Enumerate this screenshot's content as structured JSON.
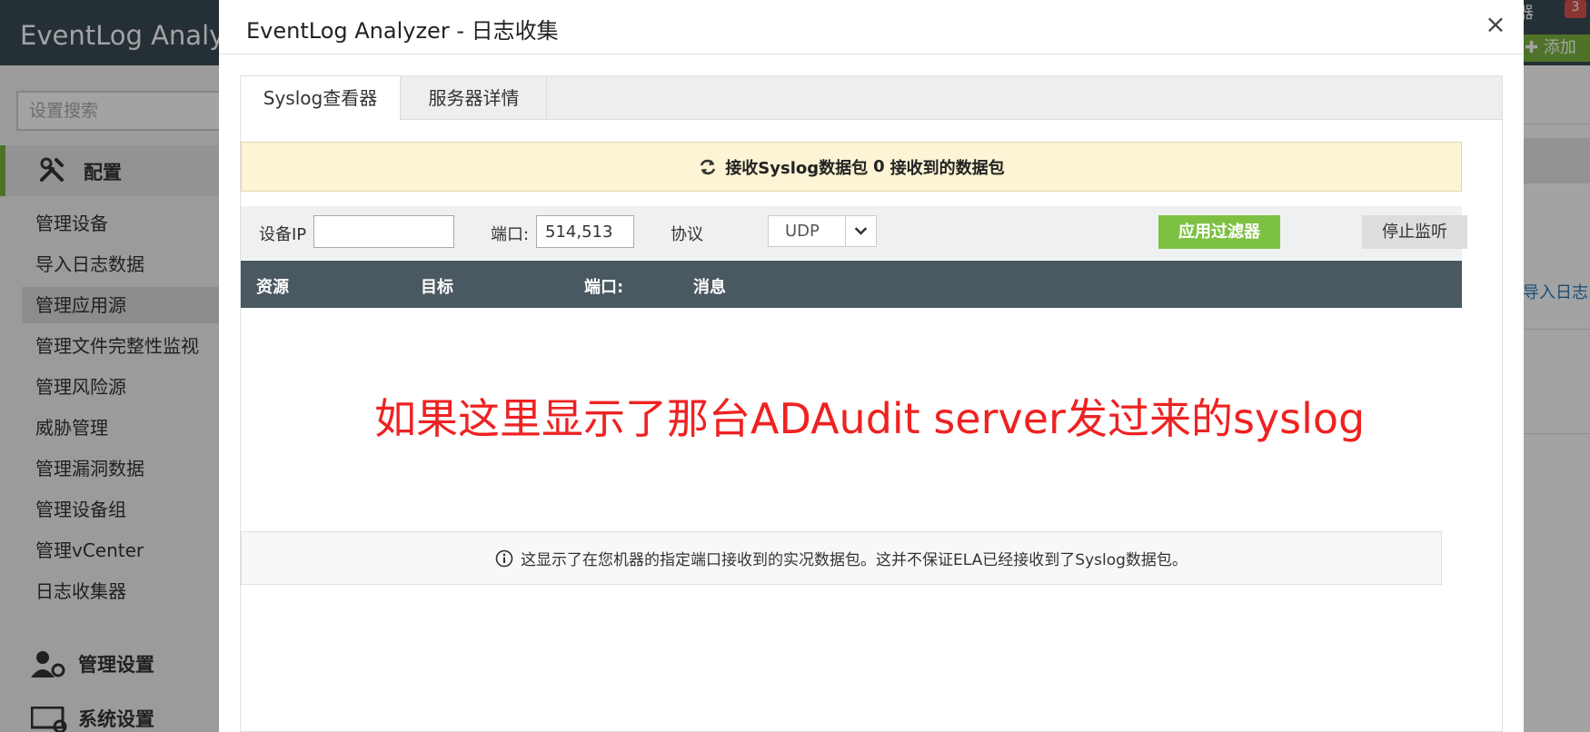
{
  "app": {
    "title": "EventLog Analyzer",
    "top_right_text": "器",
    "notification_count": "3",
    "add_label": "添加"
  },
  "sidebar": {
    "search_placeholder": "设置搜索",
    "config_label": "配置",
    "items": [
      {
        "label": "管理设备"
      },
      {
        "label": "导入日志数据"
      },
      {
        "label": "管理应用源"
      },
      {
        "label": "管理文件完整性监视"
      },
      {
        "label": "管理风险源"
      },
      {
        "label": "威胁管理"
      },
      {
        "label": "管理漏洞数据"
      },
      {
        "label": "管理设备组"
      },
      {
        "label": "管理vCenter"
      },
      {
        "label": "日志收集器"
      }
    ],
    "admin_settings_label": "管理设置",
    "system_settings_label": "系统设置"
  },
  "background": {
    "import_link": "导入日志..."
  },
  "modal": {
    "title": "EventLog Analyzer - 日志收集",
    "close_glyph": "×",
    "tabs": [
      {
        "label": "Syslog查看器"
      },
      {
        "label": "服务器详情"
      }
    ],
    "status": {
      "prefix": "接收Syslog数据包",
      "count": "0",
      "suffix": "接收到的数据包"
    },
    "filters": {
      "device_ip_label": "设备IP",
      "device_ip_value": "",
      "port_label": "端口:",
      "port_value": "514,513",
      "protocol_label": "协议",
      "protocol_value": "UDP",
      "apply_label": "应用过滤器",
      "stop_label": "停止监听"
    },
    "table": {
      "columns": [
        "资源",
        "目标",
        "端口:",
        "消息"
      ]
    },
    "annotation": "如果这里显示了那台ADAudit server发过来的syslog",
    "info_note": "这显示了在您机器的指定端口接收到的实况数据包。这并不保证ELA已经接收到了Syslog数据包。"
  },
  "colors": {
    "accent_green": "#7cc142",
    "header_dark": "#4a5861",
    "annotation_red": "#ee2222",
    "banner_yellow": "#fcf4d4"
  }
}
